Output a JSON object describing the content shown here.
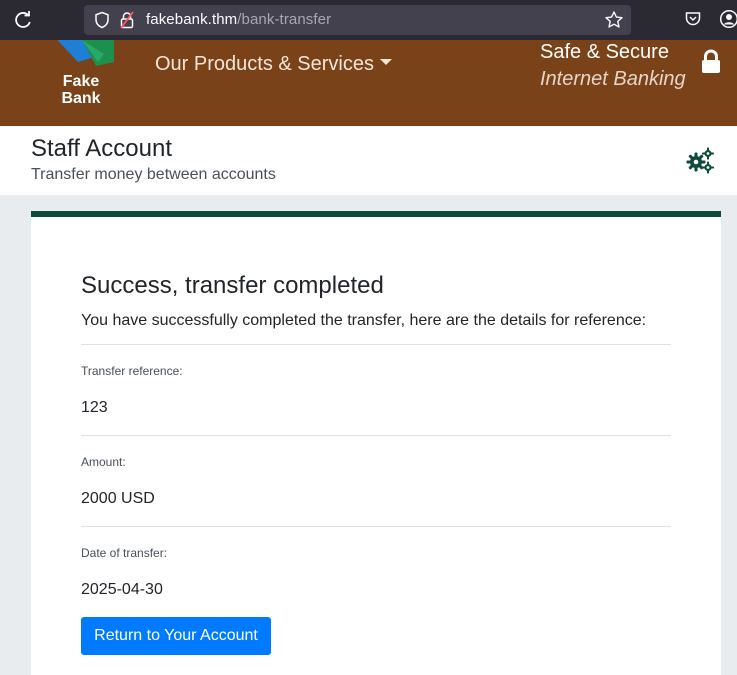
{
  "browser": {
    "url_host": "fakebank.thm",
    "url_path": "/bank-transfer",
    "icons": [
      "reload-icon",
      "shield-icon",
      "lock-alert-icon",
      "star-icon",
      "pocket-icon",
      "account-icon"
    ]
  },
  "header": {
    "logo_line1": "Fake",
    "logo_line2": "Bank",
    "nav_label": "Our Products & Services",
    "tagline_line1": "Safe & Secure",
    "tagline_line2": "Internet Banking",
    "colors": {
      "background": "#7a4218",
      "logo_green": "#1d8f4e",
      "logo_blue": "#1d7fd6"
    }
  },
  "page": {
    "title": "Staff Account",
    "subtitle": "Transfer money between accounts",
    "settings_icon": "gears-icon",
    "accent_color": "#0e4a3a"
  },
  "result": {
    "heading": "Success, transfer completed",
    "lead": "You have successfully completed the transfer, here are the details for reference:",
    "fields": [
      {
        "label": "Transfer reference:",
        "value": "123"
      },
      {
        "label": "Amount:",
        "value": "2000 USD"
      },
      {
        "label": "Date of transfer:",
        "value": "2025-04-30"
      }
    ],
    "return_button": "Return to Your Account",
    "button_color": "#007bff"
  }
}
